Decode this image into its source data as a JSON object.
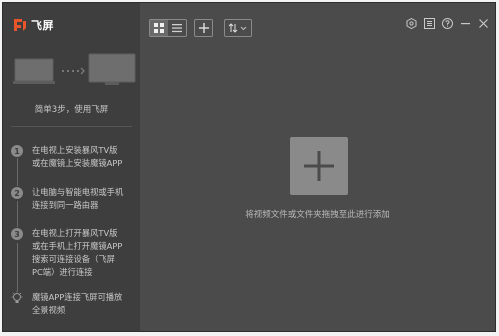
{
  "app": {
    "title": "飞屏"
  },
  "sidebar": {
    "tagline": "简单3步，使用飞屏",
    "steps": [
      {
        "num": "1",
        "lines": [
          "在电视上安装暴风TV版",
          "或在魔镜上安装魔镜APP"
        ]
      },
      {
        "num": "2",
        "lines": [
          "让电脑与智能电视或手机",
          "连接到同一路由器"
        ]
      },
      {
        "num": "3",
        "lines": [
          "在电视上打开暴风TV版",
          "或在手机上打开魔镜APP",
          "搜索可连接设备（飞屏",
          "PC端）进行连接"
        ]
      }
    ],
    "tip": {
      "lines": [
        "魔镜APP连接飞屏可播放",
        "全景视频"
      ]
    }
  },
  "toolbar": {
    "view_grid_icon": "grid-icon",
    "view_list_icon": "list-icon",
    "add_icon": "plus-icon",
    "sort_icon": "sort-icon"
  },
  "window_controls": [
    "settings-icon",
    "menu-icon",
    "help-icon",
    "minimize-icon",
    "close-icon"
  ],
  "main": {
    "drop_hint": "将视频文件或文件夹拖拽至此进行添加"
  },
  "colors": {
    "logo": "#e8552a",
    "sidebar": "#3e3e3e",
    "content": "#4b4b4b"
  }
}
